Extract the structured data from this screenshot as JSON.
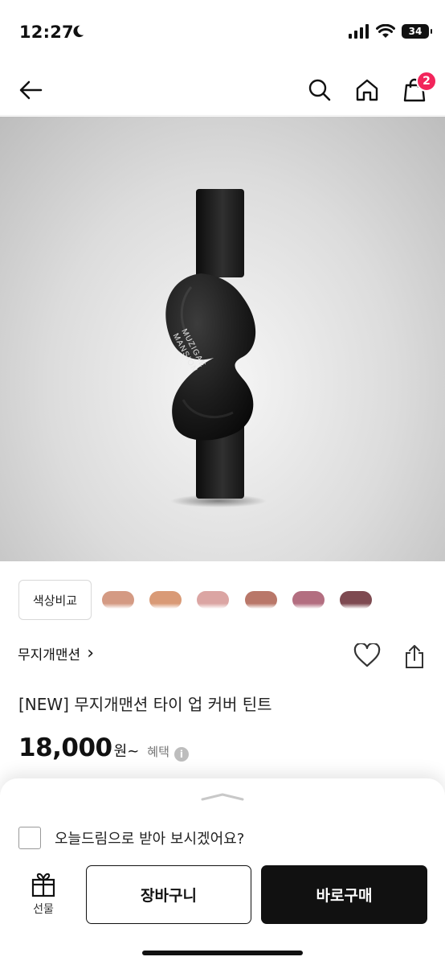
{
  "status_bar": {
    "time": "12:27",
    "battery": "34"
  },
  "nav": {
    "cart_count": "2"
  },
  "product_image": {
    "brand_print_line1": "MUZIGAE",
    "brand_print_line2": "MANSION"
  },
  "swatches": {
    "compare_label": "색상비교",
    "colors": [
      "#d49a83",
      "#d99a76",
      "#dba5a3",
      "#b97769",
      "#b36e80",
      "#7e4a51"
    ]
  },
  "product": {
    "brand": "무지개맨션",
    "brand_chevron": "›",
    "title": "[NEW] 무지개맨션 타이 업 커버 틴트",
    "price": "18,000",
    "price_unit": "원~",
    "benefit_label": "혜택",
    "info_glyph": "i"
  },
  "sheet": {
    "delivery_option": "오늘드림으로 받아 보시겠어요?",
    "gift_label": "선물",
    "cart_button": "장바구니",
    "buy_button": "바로구매"
  }
}
